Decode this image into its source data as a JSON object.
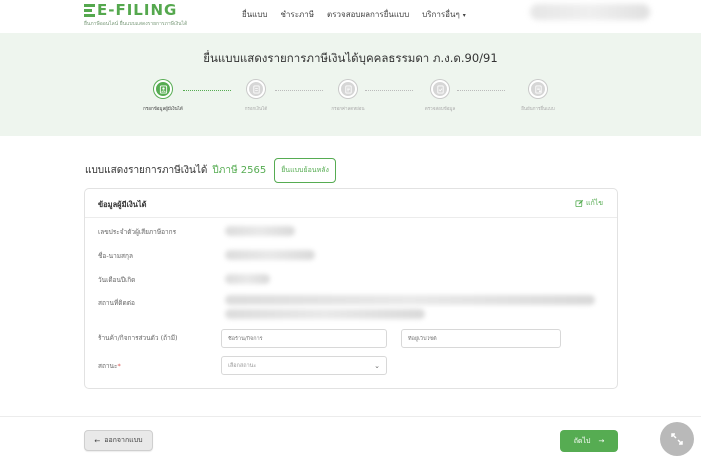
{
  "header": {
    "logo_text": "E-FILING",
    "logo_subtitle": "ยื่นภาษีออนไลน์ ยื่นแบบแสดงรายการภาษีเงินได้",
    "nav": [
      "ยื่นแบบ",
      "ชำระภาษี",
      "ตรวจสอบผลการยื่นแบบ",
      "บริการอื่นๆ"
    ]
  },
  "hero": {
    "title": "ยื่นแบบแสดงรายการภาษีเงินได้บุคคลธรรมดา ภ.ง.ด.90/91",
    "steps": [
      {
        "label": "กรอกข้อมูลผู้มีเงินได้",
        "icon": "user-form-icon",
        "active": true
      },
      {
        "label": "กรอกเงินได้",
        "icon": "money-doc-icon",
        "active": false
      },
      {
        "label": "กรอกค่าลดหย่อน",
        "icon": "deduction-doc-icon",
        "active": false
      },
      {
        "label": "ตรวจสอบข้อมูล",
        "icon": "check-doc-icon",
        "active": false
      },
      {
        "label": "ยืนยันการยื่นแบบ",
        "icon": "confirm-doc-icon",
        "active": false
      }
    ]
  },
  "section": {
    "title": "แบบแสดงรายการภาษีเงินได้",
    "year_label": "ปีภาษี 2565",
    "backfile_button": "ยื่นแบบย้อนหลัง"
  },
  "card": {
    "title": "ข้อมูลผู้มีเงินได้",
    "edit_label": "แก้ไข",
    "rows": [
      {
        "label": "เลขประจำตัวผู้เสียภาษีอากร"
      },
      {
        "label": "ชื่อ-นามสกุล"
      },
      {
        "label": "วันเดือนปีเกิด"
      },
      {
        "label": "สถานที่ติดต่อ"
      }
    ],
    "shop_label": "ร้านค้า/กิจการส่วนตัว (ถ้ามี)",
    "shop_name_placeholder": "ชื่อร้าน/กิจการ",
    "shop_web_placeholder": "ที่อยู่เว็บไซต์",
    "status_label": "สถานะ",
    "status_required": "*",
    "status_value": "เลือกสถานะ"
  },
  "footer": {
    "back_label": "ออกจากแบบ",
    "next_label": "ถัดไป"
  },
  "colors": {
    "brand_green": "#56ac52",
    "hero_bg": "#eef5ee"
  }
}
